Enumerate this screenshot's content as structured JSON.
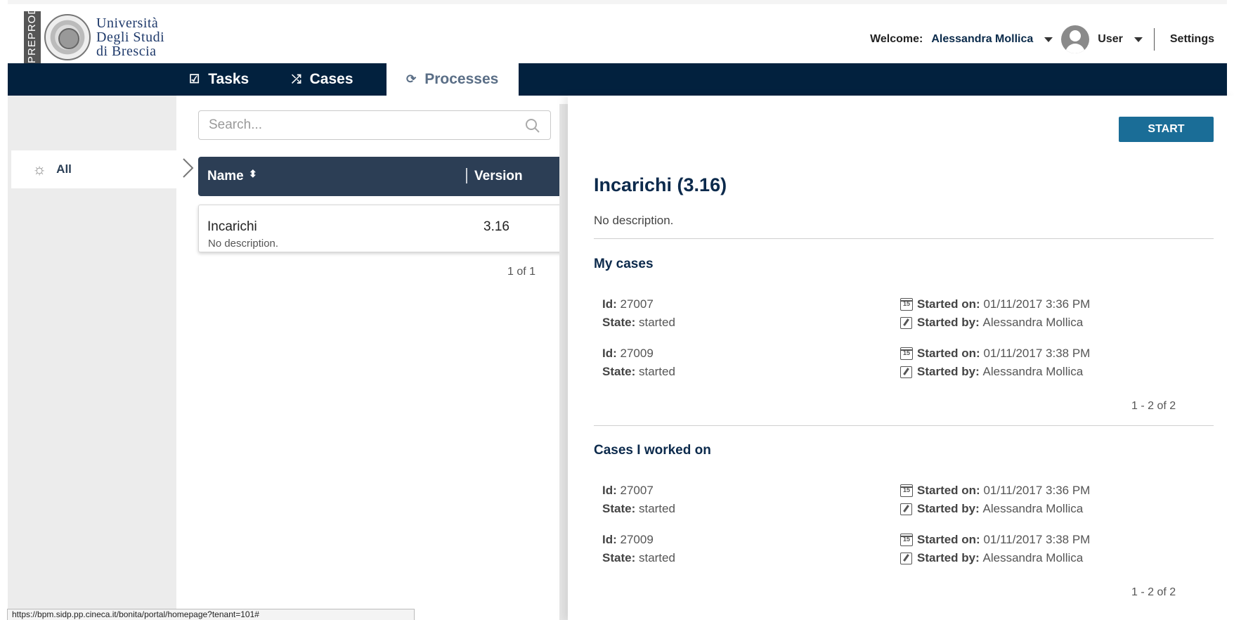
{
  "header": {
    "logo": {
      "badge": "PREPROD",
      "line1": "Università",
      "line2": "Degli Studi",
      "line3": "di Brescia"
    },
    "welcome_label": "Welcome:",
    "user_name": "Alessandra Mollica",
    "user_label": "User",
    "settings_label": "Settings"
  },
  "nav": {
    "tabs": [
      {
        "label": "Tasks",
        "icon": "checkbox-icon"
      },
      {
        "label": "Cases",
        "icon": "shuffle-icon"
      },
      {
        "label": "Processes",
        "icon": "process-icon",
        "active": true
      }
    ]
  },
  "sidebar": {
    "items": [
      {
        "label": "All",
        "icon": "sun-icon",
        "selected": true
      }
    ]
  },
  "process_list": {
    "search_placeholder": "Search...",
    "columns": {
      "name": "Name",
      "version": "Version"
    },
    "rows": [
      {
        "name": "Incarichi",
        "description": "No description.",
        "version": "3.16"
      }
    ],
    "pager": "1 of 1"
  },
  "detail": {
    "start_label": "START",
    "title": "Incarichi (3.16)",
    "description": "No description.",
    "labels": {
      "id": "Id:",
      "state": "State:",
      "started_on": "Started on:",
      "started_by": "Started by:"
    },
    "my_cases": {
      "title": "My cases",
      "cases": [
        {
          "id": "27007",
          "state": "started",
          "started_on": "01/11/2017 3:36 PM",
          "started_by": "Alessandra Mollica"
        },
        {
          "id": "27009",
          "state": "started",
          "started_on": "01/11/2017 3:38 PM",
          "started_by": "Alessandra Mollica"
        }
      ],
      "pager": "1 - 2 of 2"
    },
    "worked_on": {
      "title": "Cases I worked on",
      "cases": [
        {
          "id": "27007",
          "state": "started",
          "started_on": "01/11/2017 3:36 PM",
          "started_by": "Alessandra Mollica"
        },
        {
          "id": "27009",
          "state": "started",
          "started_on": "01/11/2017 3:38 PM",
          "started_by": "Alessandra Mollica"
        }
      ],
      "pager": "1 - 2 of 2"
    },
    "calendar_icon_text": "15"
  },
  "status_bar": {
    "url": "https://bpm.sidp.pp.cineca.it/bonita/portal/homepage?tenant=101#"
  },
  "colors": {
    "navbar": "#02213e",
    "start_button": "#1a6d97",
    "list_header": "#2c3e55",
    "title": "#0c2a4c"
  }
}
